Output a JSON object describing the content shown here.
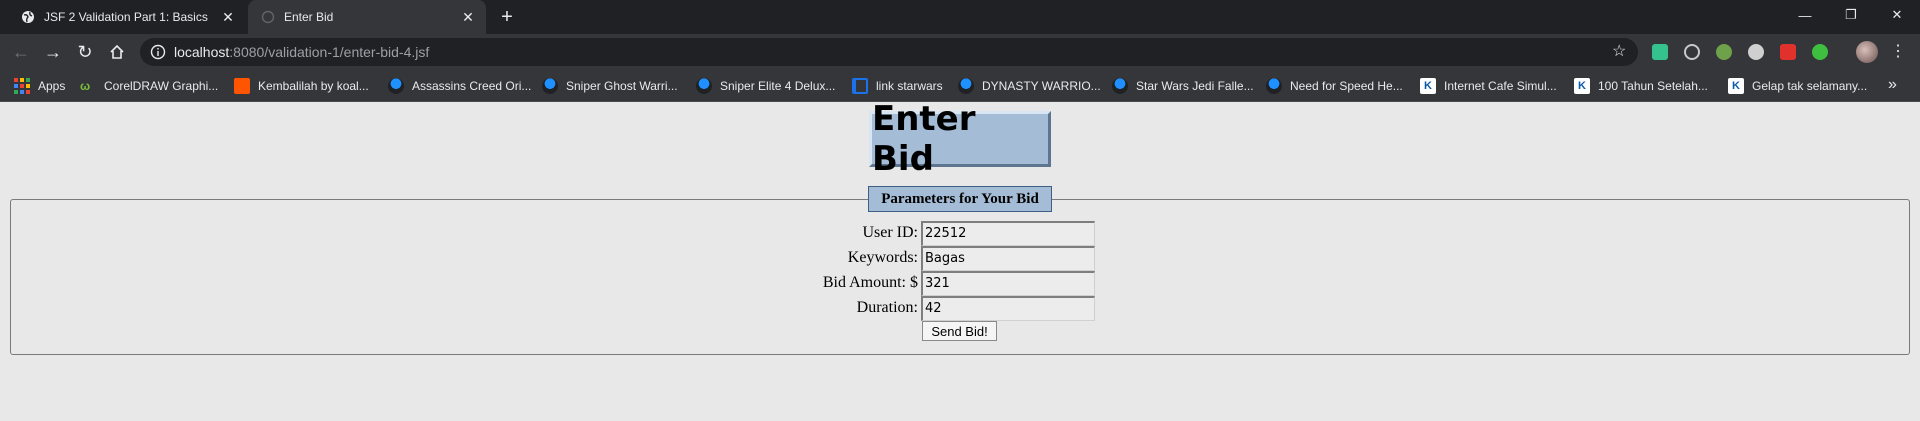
{
  "browser": {
    "tabs": [
      {
        "title": "JSF 2 Validation Part 1: Basics",
        "active": false
      },
      {
        "title": "Enter Bid",
        "active": true
      }
    ],
    "url_host": "localhost",
    "url_rest": ":8080/validation-1/enter-bid-4.jsf",
    "bookmarks": [
      {
        "label": "Apps",
        "icon": "apps-grid-icon"
      },
      {
        "label": "CorelDRAW Graphi...",
        "icon": "coreldraw-icon"
      },
      {
        "label": "Kembalilah by koal...",
        "icon": "soundcloud-icon"
      },
      {
        "label": "Assassins Creed Ori...",
        "icon": "game-site-icon"
      },
      {
        "label": "Sniper Ghost Warri...",
        "icon": "game-site-icon"
      },
      {
        "label": "Sniper Elite 4 Delux...",
        "icon": "game-site-icon"
      },
      {
        "label": "link starwars",
        "icon": "bookmark-icon"
      },
      {
        "label": "DYNASTY WARRIO...",
        "icon": "game-site-icon"
      },
      {
        "label": "Star Wars Jedi Falle...",
        "icon": "game-site-icon"
      },
      {
        "label": "Need for Speed He...",
        "icon": "game-site-icon"
      },
      {
        "label": "Internet Cafe Simul...",
        "icon": "k-site-icon"
      },
      {
        "label": "100 Tahun Setelah...",
        "icon": "k-site-icon"
      },
      {
        "label": "Gelap tak selamany...",
        "icon": "k-site-icon"
      }
    ]
  },
  "page": {
    "heading": "Enter Bid",
    "legend": "Parameters for Your Bid",
    "fields": [
      {
        "label": "User ID:",
        "value": "22512"
      },
      {
        "label": "Keywords:",
        "value": "Bagas"
      },
      {
        "label": "Bid Amount: $",
        "value": "321"
      },
      {
        "label": "Duration:",
        "value": "42"
      }
    ],
    "submit_label": "Send Bid!"
  },
  "colors": {
    "heading_box": "#a4bcd6",
    "page_bg": "#e8e8e8",
    "chrome_dark": "#202124",
    "chrome_toolbar": "#35363a"
  }
}
